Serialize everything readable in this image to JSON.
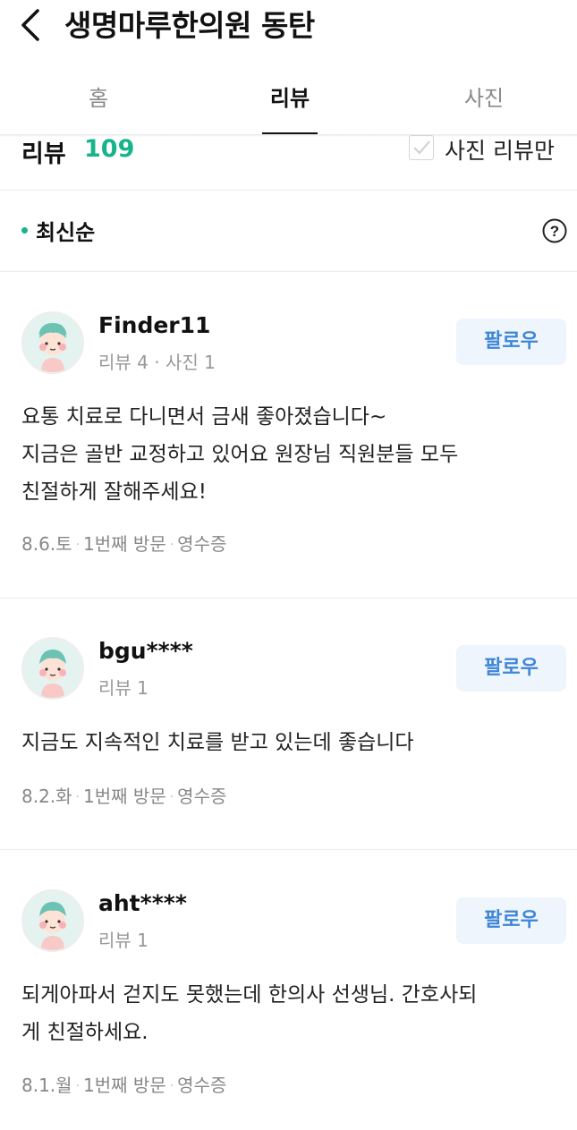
{
  "header": {
    "title": "생명마루한의원 동탄"
  },
  "tabs": [
    {
      "label": "홈"
    },
    {
      "label": "리뷰"
    },
    {
      "label": "사진"
    }
  ],
  "summary": {
    "label": "리뷰",
    "count": "109",
    "photo_only_label": "사진 리뷰만"
  },
  "sort": {
    "label": "최신순"
  },
  "follow_label": "팔로우",
  "reviews": [
    {
      "user": "Finder11",
      "stats": "리뷰 4 · 사진 1",
      "text": "요통 치료로 다니면서 금새 좋아졌습니다~\n지금은 골반 교정하고 있어요 원장님 직원분들 모두\n친절하게 잘해주세요!",
      "date": "8.6.토",
      "visit": "1번째 방문",
      "receipt": "영수증"
    },
    {
      "user": "bgu****",
      "stats": "리뷰 1",
      "text": "지금도 지속적인 치료를 받고 있는데 좋습니다",
      "date": "8.2.화",
      "visit": "1번째 방문",
      "receipt": "영수증"
    },
    {
      "user": "aht****",
      "stats": "리뷰 1",
      "text": "되게아파서 걷지도 못했는데 한의사 선생님. 간호사되\n게 친절하세요.",
      "date": "8.1.월",
      "visit": "1번째 방문",
      "receipt": "영수증"
    }
  ]
}
